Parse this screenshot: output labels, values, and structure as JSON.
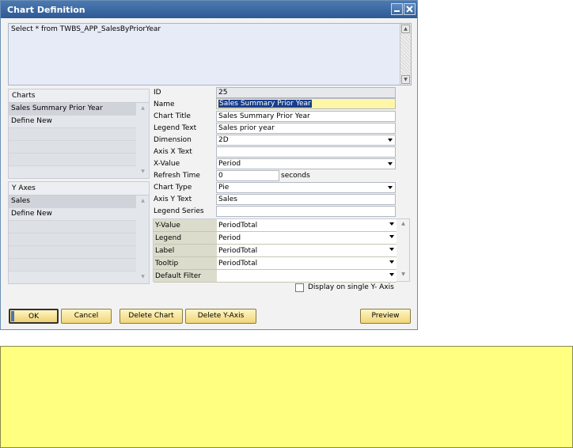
{
  "window": {
    "title": "Chart Definition"
  },
  "query": {
    "text": "Select * from TWBS_APP_SalesByPriorYear"
  },
  "charts_list": {
    "header": "Charts",
    "items": [
      "Sales Summary Prior Year",
      "Define New"
    ]
  },
  "yaxes_list": {
    "header": "Y Axes",
    "items": [
      "Sales",
      "Define New"
    ]
  },
  "form": {
    "id_label": "ID",
    "id_value": "25",
    "name_label": "Name",
    "name_value": "Sales Summary Prior Year",
    "chart_title_label": "Chart Title",
    "chart_title_value": "Sales Summary Prior Year",
    "legend_text_label": "Legend Text",
    "legend_text_value": "Sales prior year",
    "dimension_label": "Dimension",
    "dimension_value": "2D",
    "axis_x_text_label": "Axis X Text",
    "axis_x_text_value": "",
    "x_value_label": "X-Value",
    "x_value_value": "Period",
    "refresh_time_label": "Refresh Time",
    "refresh_time_value": "0",
    "refresh_time_unit": "seconds",
    "chart_type_label": "Chart Type",
    "chart_type_value": "Pie",
    "axis_y_text_label": "Axis Y Text",
    "axis_y_text_value": "Sales",
    "legend_series_label": "Legend Series",
    "legend_series_value": ""
  },
  "series_grid": {
    "rows": [
      {
        "label": "Y-Value",
        "value": "PeriodTotal"
      },
      {
        "label": "Legend",
        "value": "Period"
      },
      {
        "label": "Label",
        "value": "PeriodTotal"
      },
      {
        "label": "Tooltip",
        "value": "PeriodTotal"
      },
      {
        "label": "Default Filter",
        "value": ""
      }
    ]
  },
  "options": {
    "single_y_axis_label": "Display on single Y- Axis"
  },
  "buttons": {
    "ok": "OK",
    "cancel": "Cancel",
    "delete_chart": "Delete Chart",
    "delete_y_axis": "Delete Y-Axis",
    "preview": "Preview"
  },
  "colors": {
    "titlebar": "#2d5a94",
    "button": "#f1d57a",
    "tooltip_panel": "#ffff80",
    "focus_field": "#fff6a8"
  }
}
